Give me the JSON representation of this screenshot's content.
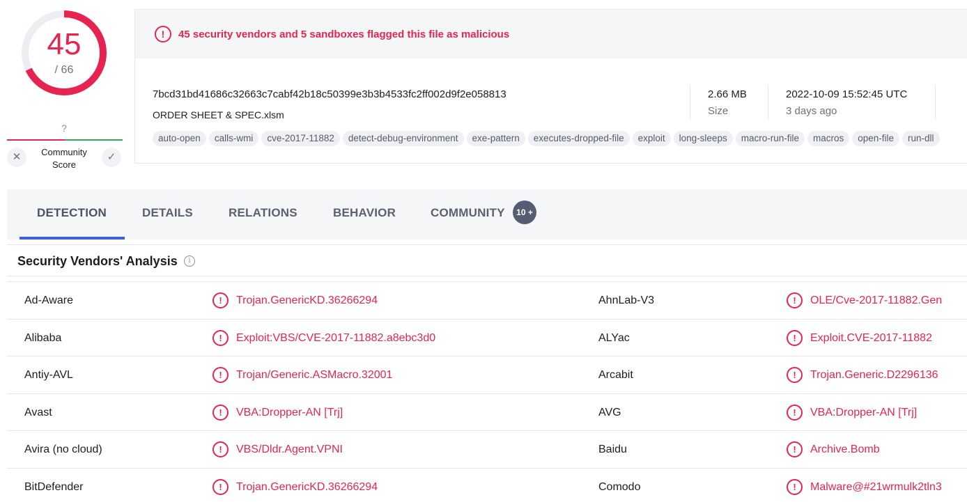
{
  "score": {
    "detections": "45",
    "total": "/ 66",
    "fraction": 0.68,
    "color": "#e5254f"
  },
  "community": {
    "value": "?",
    "label": "Community Score",
    "down_icon": "close-icon",
    "up_icon": "check-icon"
  },
  "alert": {
    "icon": "alert-circle-icon",
    "text": "45 security vendors and 5 sandboxes flagged this file as malicious"
  },
  "file": {
    "hash": "7bcd31bd41686c32663c7cabf42b18c50399e3b3b4533fc2ff002d9f2e058813",
    "name": "ORDER SHEET & SPEC.xlsm",
    "size_value": "2.66 MB",
    "size_label": "Size",
    "date_value": "2022-10-09 15:52:45 UTC",
    "date_relative": "3 days ago"
  },
  "tags": [
    "auto-open",
    "calls-wmi",
    "cve-2017-11882",
    "detect-debug-environment",
    "exe-pattern",
    "executes-dropped-file",
    "exploit",
    "long-sleeps",
    "macro-run-file",
    "macros",
    "open-file",
    "run-dll"
  ],
  "tabs": {
    "detection": "DETECTION",
    "details": "DETAILS",
    "relations": "RELATIONS",
    "behavior": "BEHAVIOR",
    "community": "COMMUNITY",
    "community_badge": "10 +",
    "active": "detection",
    "accent": "#3b61d6"
  },
  "section": {
    "title": "Security Vendors' Analysis",
    "info_icon": "info-icon"
  },
  "vendors": [
    {
      "v1": "Ad-Aware",
      "r1": "Trojan.GenericKD.36266294",
      "v2": "AhnLab-V3",
      "r2": "OLE/Cve-2017-11882.Gen"
    },
    {
      "v1": "Alibaba",
      "r1": "Exploit:VBS/CVE-2017-11882.a8ebc3d0",
      "v2": "ALYac",
      "r2": "Exploit.CVE-2017-11882"
    },
    {
      "v1": "Antiy-AVL",
      "r1": "Trojan/Generic.ASMacro.32001",
      "v2": "Arcabit",
      "r2": "Trojan.Generic.D2296136"
    },
    {
      "v1": "Avast",
      "r1": "VBA:Dropper-AN [Trj]",
      "v2": "AVG",
      "r2": "VBA:Dropper-AN [Trj]"
    },
    {
      "v1": "Avira (no cloud)",
      "r1": "VBS/Dldr.Agent.VPNI",
      "v2": "Baidu",
      "r2": "Archive.Bomb"
    },
    {
      "v1": "BitDefender",
      "r1": "Trojan.GenericKD.36266294",
      "v2": "Comodo",
      "r2": "Malware@#21wrmulk2tln3"
    }
  ]
}
